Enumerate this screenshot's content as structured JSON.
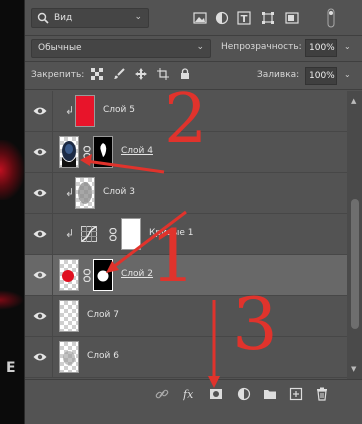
{
  "filter": {
    "kind_label": "Вид"
  },
  "blend": {
    "mode": "Обычные",
    "opacity_label": "Непрозрачность:",
    "opacity_value": "100%"
  },
  "lock": {
    "label": "Закрепить:",
    "fill_label": "Заливка:",
    "fill_value": "100%"
  },
  "layers": [
    {
      "name": "Слой 5",
      "clipped": true,
      "thumb": "red"
    },
    {
      "name": "Слой 4",
      "clipped": false,
      "thumb": "face",
      "mask": true,
      "underline": true
    },
    {
      "name": "Слой 3",
      "clipped": true,
      "thumb": "gray"
    },
    {
      "name": "Кривые 1",
      "clipped": true,
      "thumb": "curves",
      "mask": true
    },
    {
      "name": "Слой 2",
      "clipped": false,
      "thumb": "redball",
      "mask": true,
      "underline": true,
      "selected": true
    },
    {
      "name": "Слой 7",
      "clipped": false,
      "thumb": "checker"
    },
    {
      "name": "Слой 6",
      "clipped": false,
      "thumb": "smoke"
    }
  ],
  "annotations": {
    "n1": "1",
    "n2": "2",
    "n3": "3"
  },
  "colors": {
    "annotation": "#e0332c",
    "panel": "#535353",
    "selected_row": "#686868",
    "layer5_fill": "#e8142a"
  },
  "icons": [
    "search-icon",
    "image-filter-icon",
    "adjustment-filter-icon",
    "type-filter-icon",
    "shape-filter-icon",
    "smart-object-filter-icon",
    "filter-toggle-icon",
    "lock-pixels-icon",
    "lock-paint-icon",
    "lock-move-icon",
    "lock-artboard-icon",
    "lock-all-icon",
    "eye-icon",
    "link-icon",
    "fx-icon",
    "mask-icon",
    "adjustment-icon",
    "folder-icon",
    "new-layer-icon",
    "trash-icon"
  ]
}
